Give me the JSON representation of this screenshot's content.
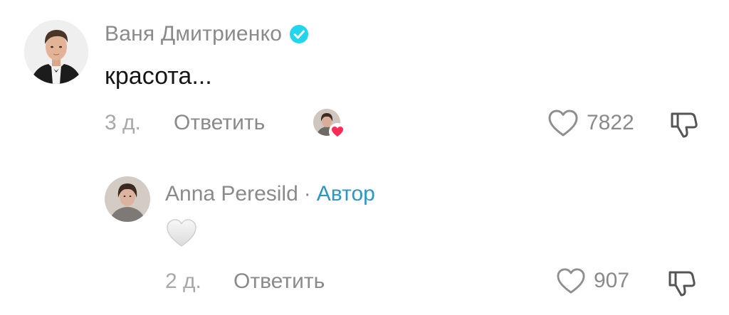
{
  "comment": {
    "username": "Ваня Дмитриенко",
    "verified": true,
    "text": "красота...",
    "time": "3 д.",
    "reply_label": "Ответить",
    "creator_liked": true,
    "likes": "7822",
    "icons": {
      "verified": "verified-check-icon",
      "like": "heart-outline-icon",
      "dislike": "thumb-down-icon",
      "creator_like": "heart-badge-icon"
    }
  },
  "reply": {
    "username": "Anna Peresild",
    "separator": "·",
    "author_label": "Автор",
    "text_emoji": "white-heart",
    "time": "2 д.",
    "reply_label": "Ответить",
    "likes": "907",
    "icons": {
      "like": "heart-outline-icon",
      "dislike": "thumb-down-icon"
    }
  },
  "colors": {
    "verified": "#20d5ec",
    "author_accent": "#2b97c9",
    "creator_heart": "#fe2c55",
    "muted_text": "#8a8a8a"
  }
}
